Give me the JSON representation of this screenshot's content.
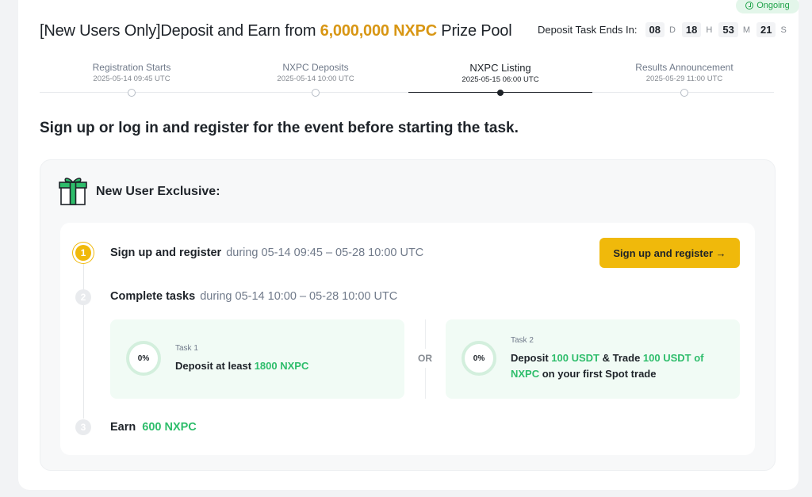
{
  "status": {
    "label": "Ongoing"
  },
  "header": {
    "title_pre": "[New Users Only]Deposit and Earn from ",
    "title_highlight": "6,000,000 NXPC",
    "title_post": " Prize Pool",
    "countdown": {
      "label": "Deposit Task Ends In:",
      "days": "08",
      "days_unit": "D",
      "hours": "18",
      "hours_unit": "H",
      "minutes": "53",
      "minutes_unit": "M",
      "seconds": "21",
      "seconds_unit": "S"
    }
  },
  "timeline": [
    {
      "name": "Registration Starts",
      "date": "2025-05-14 09:45 UTC"
    },
    {
      "name": "NXPC  Deposits",
      "date": "2025-05-14 10:00 UTC"
    },
    {
      "name": "NXPC  Listing",
      "date": "2025-05-15 06:00 UTC"
    },
    {
      "name": "Results Announcement",
      "date": "2025-05-29 11:00 UTC"
    }
  ],
  "subtitle": "Sign up or log in and register for the event before starting the task.",
  "panel": {
    "heading": "New User Exclusive:",
    "steps": [
      {
        "num": "1",
        "title": "Sign up and register",
        "detail": "during 05-14 09:45 – 05-28 10:00 UTC"
      },
      {
        "num": "2",
        "title": "Complete tasks",
        "detail": "during 05-14 10:00 – 05-28 10:00 UTC"
      },
      {
        "num": "3",
        "title": "Earn",
        "reward": "600 NXPC"
      }
    ],
    "cta_label": "Sign up and register →",
    "or_label": "OR",
    "tasks": [
      {
        "label": "Task 1",
        "progress": "0%",
        "text_a": "Deposit at least ",
        "green_a": "1800 NXPC"
      },
      {
        "label": "Task 2",
        "progress": "0%",
        "text_a": "Deposit ",
        "green_a": "100 USDT",
        "text_b": " & Trade ",
        "green_b": "100 USDT of NXPC",
        "text_c": " on your first Spot trade"
      }
    ]
  },
  "colors": {
    "accent": "#f0b90b",
    "highlight": "#d89613",
    "green": "#2ebd6b"
  },
  "icons": {
    "status": "clock-icon",
    "panel": "gift-icon"
  }
}
